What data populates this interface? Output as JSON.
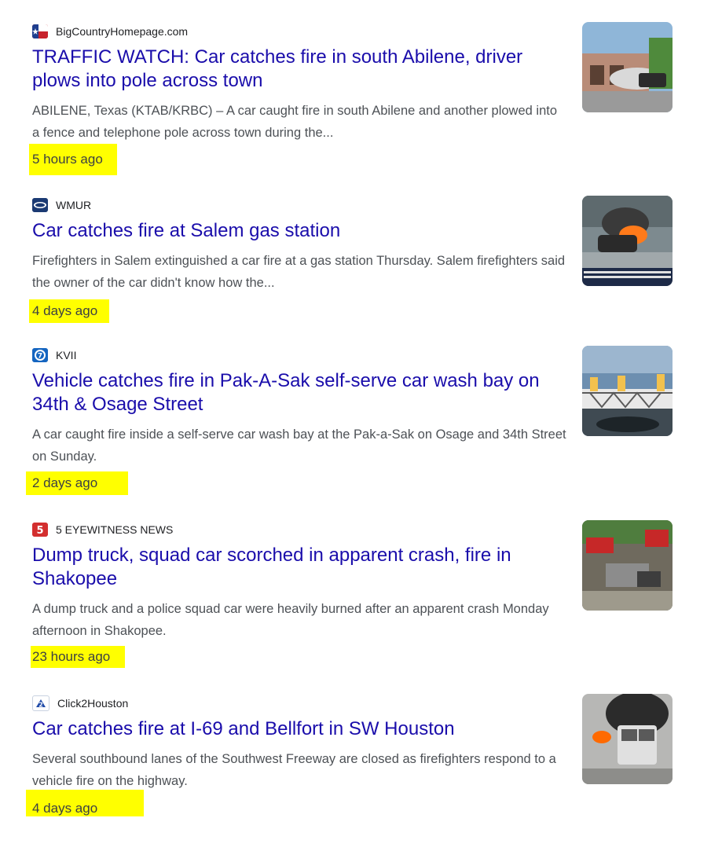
{
  "results": [
    {
      "source": "BigCountryHomepage.com",
      "logo_icon": "texas-flag-icon",
      "headline": "TRAFFIC WATCH: Car catches fire in south Abilene, driver plows into pole across town",
      "snippet": "ABILENE, Texas (KTAB/KRBC) – A car caught fire in south Abilene and another plowed into a fence and telephone pole across town during the...",
      "time": "5 hours ago"
    },
    {
      "source": "WMUR",
      "logo_icon": "wmur-logo-icon",
      "headline": "Car catches fire at Salem gas station",
      "snippet": "Firefighters in Salem extinguished a car fire at a gas station Thursday. Salem firefighters said the owner of the car didn't know how the...",
      "time": "4 days ago"
    },
    {
      "source": "KVII",
      "logo_icon": "abc7-logo-icon",
      "headline": "Vehicle catches fire in Pak-A-Sak self-serve car wash bay on 34th & Osage Street",
      "snippet": "A car caught fire inside a self-serve car wash bay at the Pak-a-Sak on Osage and 34th Street on Sunday.",
      "time": "2 days ago"
    },
    {
      "source": "5 EYEWITNESS NEWS",
      "logo_icon": "ksp5-logo-icon",
      "headline": "Dump truck, squad car scorched in apparent crash, fire in Shakopee",
      "snippet": "A dump truck and a police squad car were heavily burned after an apparent crash Monday afternoon in Shakopee.",
      "time": "23 hours ago"
    },
    {
      "source": "Click2Houston",
      "logo_icon": "kprc2-logo-icon",
      "headline": "Car catches fire at I-69 and Bellfort in SW Houston",
      "snippet": "Several southbound lanes of the Southwest Freeway are closed as firefighters respond to a vehicle fire on the highway.",
      "time": "4 days ago"
    }
  ],
  "colors": {
    "headline": "#1a0dab",
    "snippet": "#4d5156",
    "highlight": "#ffff00"
  }
}
